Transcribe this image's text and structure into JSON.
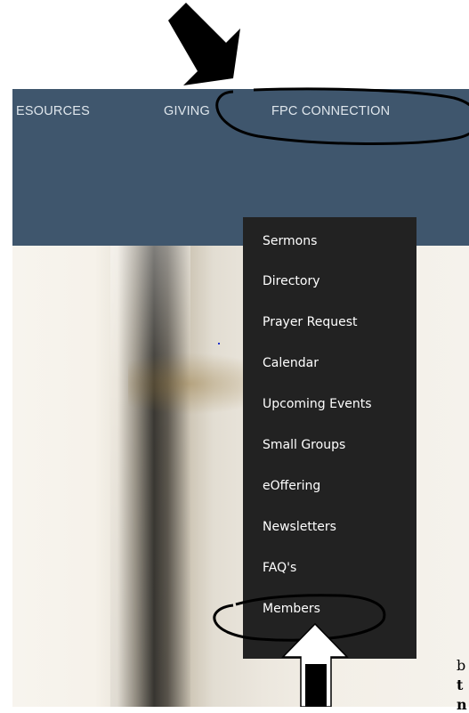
{
  "nav": {
    "items": [
      "ESOURCES",
      "GIVING",
      "FPC CONNECTION"
    ],
    "background": "#3f566d",
    "text_color": "#dfe6ec"
  },
  "dropdown": {
    "background": "#222222",
    "items": [
      "Sermons",
      "Directory",
      "Prayer Request",
      "Calendar",
      "Upcoming Events",
      "Small Groups",
      "eOffering",
      "Newsletters",
      "FAQ's",
      "Members"
    ]
  },
  "side_text": [
    "b",
    "t",
    "n"
  ],
  "annotations": {
    "icons": [
      "arrow-down-right-icon",
      "arrow-up-icon"
    ],
    "highlight_color": "#000000"
  }
}
